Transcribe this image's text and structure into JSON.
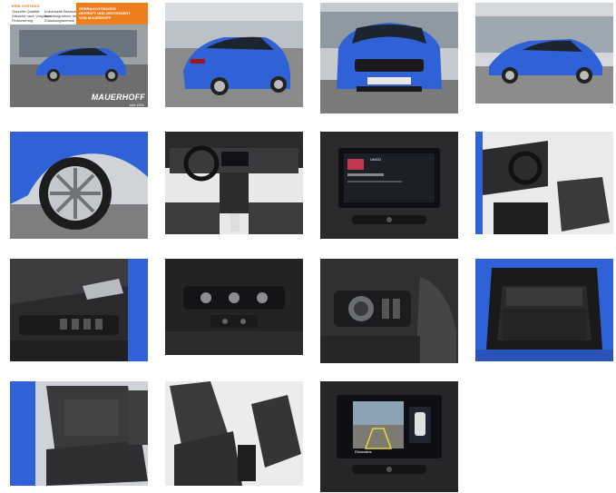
{
  "gallery": {
    "banner": {
      "heading": "IHRE VORTEILE",
      "left_lines": [
        "Geprüfte Qualität",
        "Garantie nach Vorgaben",
        "Finanzierung"
      ],
      "middle_lines": [
        "Individuelle Beratung",
        "Inzahlungnahme Ihres Fahrzeugs",
        "Zulassungsservice"
      ],
      "right_lines": [
        "GEBRAUCHTWAGEN",
        "GEPRÜFT UND ZERTIFIZIERT",
        "VON MAUERHOFF"
      ]
    },
    "logo": "MAUERHOFF",
    "logo_sub": "seit 1931",
    "infotainment_brand": "UNGO",
    "camera_label": "Rückwärts",
    "colors": {
      "car_blue": "#2f62d6",
      "banner_orange": "#ee7d1e"
    }
  }
}
